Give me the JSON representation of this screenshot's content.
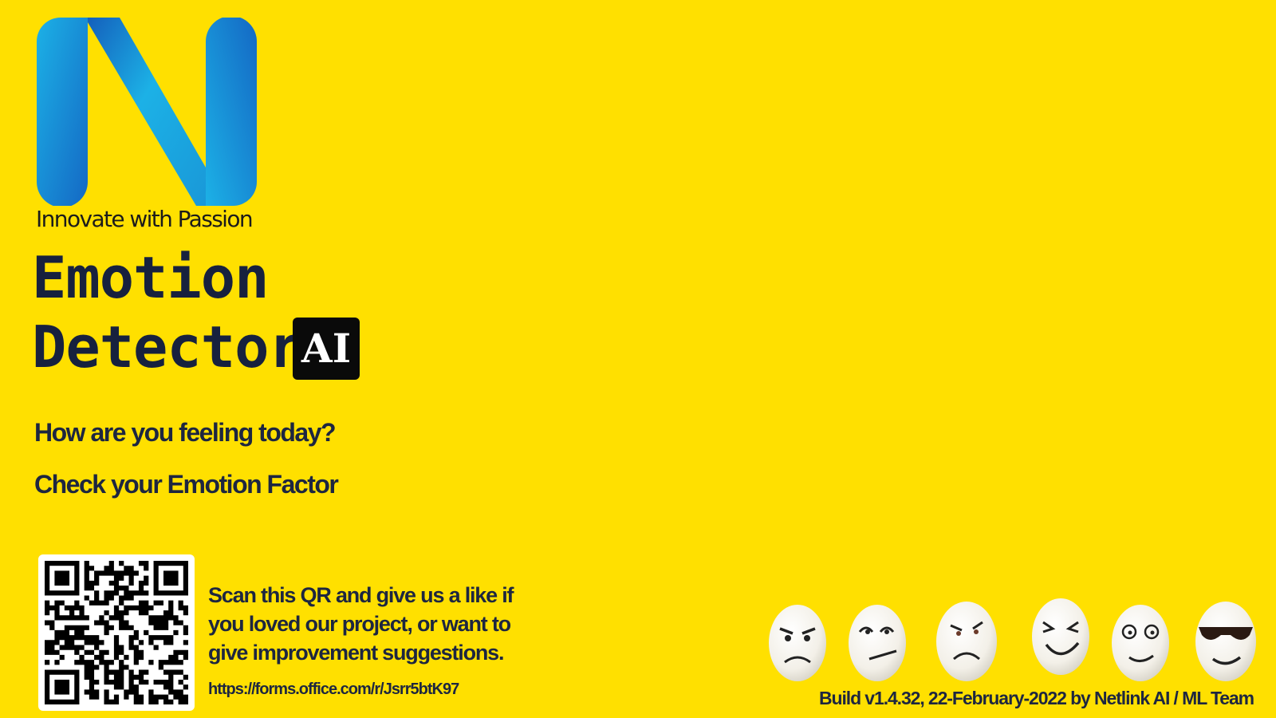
{
  "brand": {
    "tagline": "Innovate with Passion",
    "colors": {
      "background": "#FFE000",
      "logo_light": "#1CB1E6",
      "logo_dark": "#1468C4",
      "text_dark": "#1d2640"
    }
  },
  "title": {
    "line1": "Emotion",
    "line2": "Detector",
    "badge": "AI"
  },
  "prompts": {
    "question": "How are you feeling today?",
    "cta": "Check your Emotion Factor"
  },
  "feedback": {
    "line1": "Scan this QR and give us a like if",
    "line2": "you loved our project, or want to",
    "line3": "give improvement suggestions.",
    "url": "https://forms.office.com/r/Jsrr5btK97"
  },
  "footer": {
    "build": "Build v1.4.32, 22-February-2022 by Netlink AI / ML Team"
  },
  "icons": {
    "logo": "netlink-n-logo",
    "qr": "qr-code",
    "eggs": [
      "angry-egg",
      "skeptical-egg",
      "annoyed-egg",
      "laughing-egg",
      "surprised-egg",
      "cool-sunglasses-egg"
    ]
  }
}
